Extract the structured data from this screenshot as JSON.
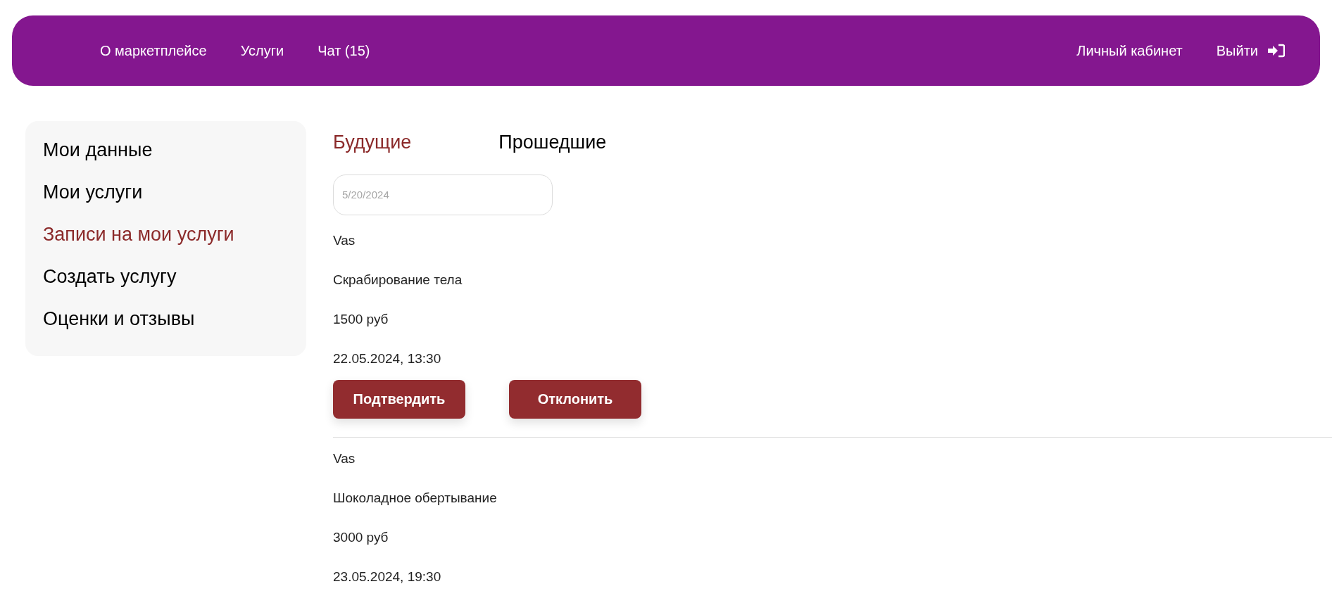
{
  "header": {
    "nav": [
      "О маркетплейсе",
      "Услуги",
      "Чат (15)"
    ],
    "account": "Личный кабинет",
    "logout": "Выйти"
  },
  "sidebar": {
    "items": [
      {
        "label": "Мои данные",
        "selected": false
      },
      {
        "label": "Мои услуги",
        "selected": false
      },
      {
        "label": "Записи на мои услуги",
        "selected": true
      },
      {
        "label": "Создать услугу",
        "selected": false
      },
      {
        "label": "Оценки и отзывы",
        "selected": false
      }
    ]
  },
  "tabs": [
    {
      "label": "Будущие",
      "selected": true
    },
    {
      "label": "Прошедшие",
      "selected": false
    }
  ],
  "date_filter": {
    "value": "5/20/2024"
  },
  "bookings": [
    {
      "client": "Vas",
      "service": "Скрабирование тела",
      "price": "1500 руб",
      "datetime": "22.05.2024, 13:30",
      "buttons": [
        "Подтвердить",
        "Отклонить"
      ]
    },
    {
      "client": "Vas",
      "service": "Шоколадное обертывание",
      "price": "3000 руб",
      "datetime": "23.05.2024, 19:30"
    }
  ]
}
